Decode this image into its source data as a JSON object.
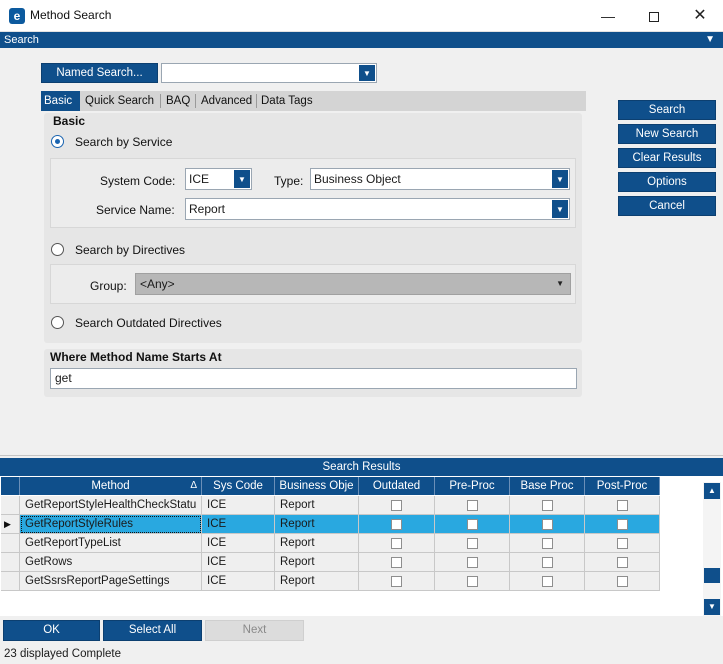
{
  "window": {
    "title": "Method Search",
    "icon_letter": "e"
  },
  "search_band": {
    "label": "Search"
  },
  "named_search": {
    "button_label": "Named Search...",
    "value": ""
  },
  "tabs": [
    "Basic",
    "Quick Search",
    "BAQ",
    "Advanced",
    "Data Tags"
  ],
  "basic": {
    "heading": "Basic",
    "search_by_service": "Search by Service",
    "system_code_label": "System Code:",
    "system_code_value": "ICE",
    "type_label": "Type:",
    "type_value": "Business Object",
    "service_name_label": "Service Name:",
    "service_name_value": "Report",
    "search_by_directives": "Search by Directives",
    "group_label": "Group:",
    "group_value": "<Any>",
    "search_outdated": "Search Outdated Directives",
    "method_starts_label": "Where Method Name Starts At",
    "method_starts_value": "get"
  },
  "actions": [
    "Search",
    "New Search",
    "Clear Results",
    "Options",
    "Cancel"
  ],
  "results": {
    "title": "Search Results",
    "columns": [
      "Method",
      "Sys Code",
      "Business Obje",
      "Outdated",
      "Pre-Proc",
      "Base Proc",
      "Post-Proc"
    ],
    "sort_indicator": "Δ",
    "rows": [
      {
        "method": "GetReportStyleHealthCheckStatu",
        "sys_code": "ICE",
        "business_object": "Report"
      },
      {
        "method": "GetReportStyleRules",
        "sys_code": "ICE",
        "business_object": "Report"
      },
      {
        "method": "GetReportTypeList",
        "sys_code": "ICE",
        "business_object": "Report"
      },
      {
        "method": "GetRows",
        "sys_code": "ICE",
        "business_object": "Report"
      },
      {
        "method": "GetSsrsReportPageSettings",
        "sys_code": "ICE",
        "business_object": "Report"
      }
    ]
  },
  "footer_buttons": {
    "ok": "OK",
    "select_all": "Select All",
    "next": "Next"
  },
  "status": "23 displayed Complete",
  "colors": {
    "accent": "#0f4f8b",
    "selected_row": "#29a8e0"
  },
  "icons": [
    "app-logo-icon",
    "minimize-icon",
    "maximize-icon",
    "close-icon",
    "pin-icon",
    "chevron-down-icon",
    "row-pointer-icon",
    "scroll-up-icon",
    "scroll-down-icon"
  ]
}
